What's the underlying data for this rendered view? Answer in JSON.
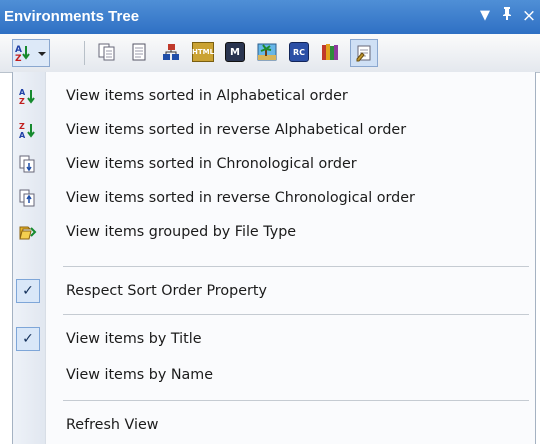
{
  "window": {
    "title": "Environments Tree",
    "controls": [
      {
        "name": "dropdown-icon",
        "glyph": "▼"
      },
      {
        "name": "pin-icon",
        "glyph": "ᵖ"
      },
      {
        "name": "close-icon",
        "glyph": "×"
      }
    ]
  },
  "toolbar": {
    "tools": [
      {
        "name": "sort-dropdown-button",
        "icon": "sort-az-icon",
        "active": true
      },
      {
        "name": "copy-tool",
        "icon": "copy-pages-icon"
      },
      {
        "name": "document-tool",
        "icon": "document-icon"
      },
      {
        "name": "hierarchy-tool",
        "icon": "hierarchy-icon"
      },
      {
        "name": "html-tool",
        "icon": "html-icon",
        "text": "HTML"
      },
      {
        "name": "m-tool",
        "icon": "m-icon",
        "text": "M"
      },
      {
        "name": "image-tool",
        "icon": "picture-icon"
      },
      {
        "name": "rc-tool",
        "icon": "rc-icon",
        "text": "RC"
      },
      {
        "name": "books-tool",
        "icon": "books-icon"
      },
      {
        "name": "properties-tool",
        "icon": "properties-icon",
        "active": true
      }
    ]
  },
  "menu": {
    "items": [
      {
        "label": "View items sorted in Alphabetical order",
        "icon": "sort-az-icon"
      },
      {
        "label": "View items sorted in reverse Alphabetical order",
        "icon": "sort-za-icon"
      },
      {
        "label": "View items sorted in Chronological order",
        "icon": "sort-chronological-icon"
      },
      {
        "label": "View items sorted in reverse Chronological order",
        "icon": "sort-reverse-chronological-icon"
      },
      {
        "label": "View items grouped by File Type",
        "icon": "group-filetype-icon"
      },
      {
        "label": "Respect Sort Order Property",
        "checked": true
      },
      {
        "label": "View items by Title",
        "checked": true
      },
      {
        "label": "View items by Name",
        "checked": false
      },
      {
        "label": "Refresh View"
      }
    ]
  },
  "colors": {
    "titlebar": "#2f70c4",
    "menu_bg": "#fafbfd",
    "check_bg": "#d9e7f8"
  }
}
